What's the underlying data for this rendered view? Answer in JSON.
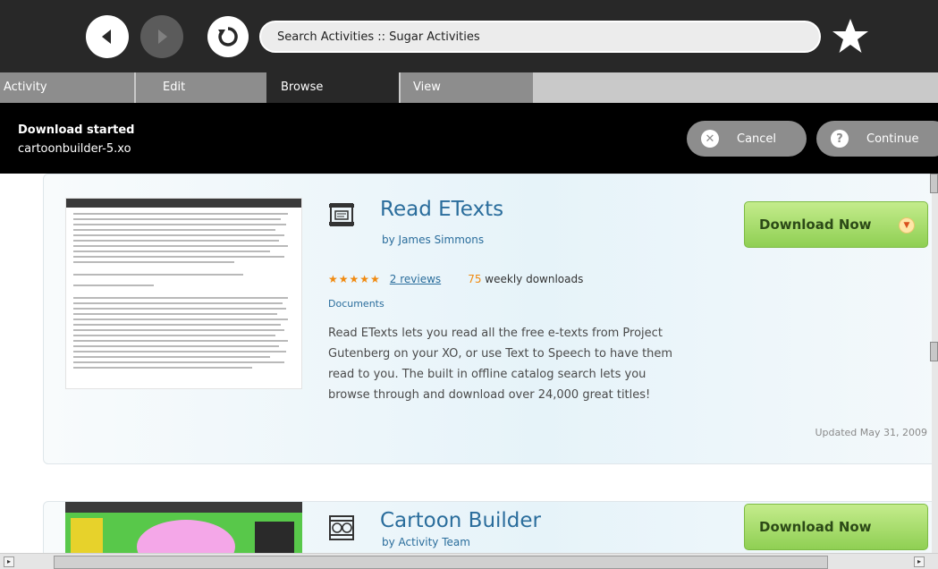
{
  "toolbar": {
    "search_text": "Search Activities :: Sugar Activities"
  },
  "tabs": [
    "Activity",
    "Edit",
    "Browse",
    "View"
  ],
  "download": {
    "title": "Download started",
    "file": "cartoonbuilder-5.xo",
    "cancel_label": "Cancel",
    "continue_label": "Continue"
  },
  "results": [
    {
      "name": "Read ETexts",
      "author": "by James Simmons",
      "stars": "★★★★★",
      "reviews": "2 reviews",
      "weekly_count": "75",
      "weekly_label": "weekly downloads",
      "category": "Documents",
      "description": "Read ETexts lets you read all the free e-texts from Project Gutenberg on your XO, or use Text to Speech to have them read to you. The built in offline catalog search lets you browse through and download over 24,000 great titles!",
      "updated": "Updated May 31, 2009",
      "button": "Download Now"
    },
    {
      "name": "Cartoon Builder",
      "author": "by Activity Team",
      "button": "Download Now"
    }
  ],
  "colors": {
    "accent": "#2a6d9c",
    "download_button": "#a7dd6c",
    "toolbar": "#282828",
    "stars": "#f08a10"
  },
  "icons": [
    "back-arrow-icon",
    "forward-arrow-icon",
    "reload-icon",
    "star-icon",
    "cancel-icon",
    "help-icon",
    "read-activity-icon",
    "cartoon-builder-activity-icon",
    "dropdown-arrow-icon"
  ]
}
